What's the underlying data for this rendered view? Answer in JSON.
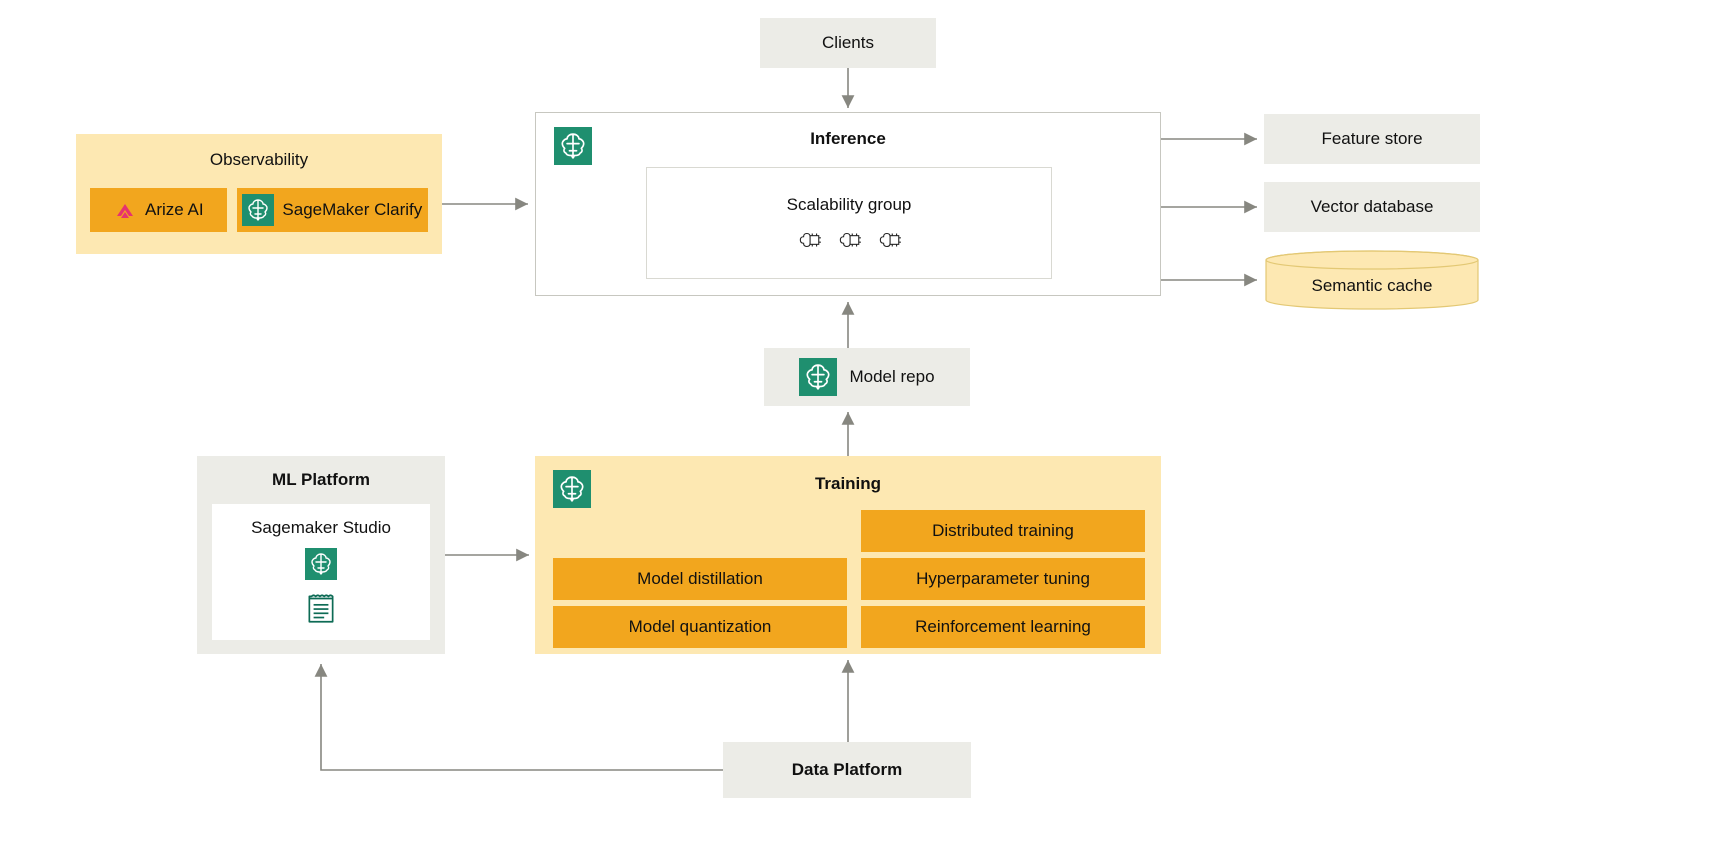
{
  "clients": {
    "label": "Clients"
  },
  "inference": {
    "title": "Inference",
    "scalability": {
      "label": "Scalability group"
    }
  },
  "observability": {
    "title": "Observability",
    "arize": "Arize AI",
    "clarify": "SageMaker Clarify"
  },
  "right": {
    "feature_store": "Feature store",
    "vector_db": "Vector database",
    "semantic_cache": "Semantic cache"
  },
  "model_repo": {
    "label": "Model repo"
  },
  "training": {
    "title": "Training",
    "distributed": "Distributed training",
    "distillation": "Model distillation",
    "hyperparam": "Hyperparameter tuning",
    "quantization": "Model quantization",
    "reinforcement": "Reinforcement learning"
  },
  "ml_platform": {
    "title": "ML Platform",
    "studio": "Sagemaker Studio"
  },
  "data_platform": {
    "label": "Data Platform"
  }
}
